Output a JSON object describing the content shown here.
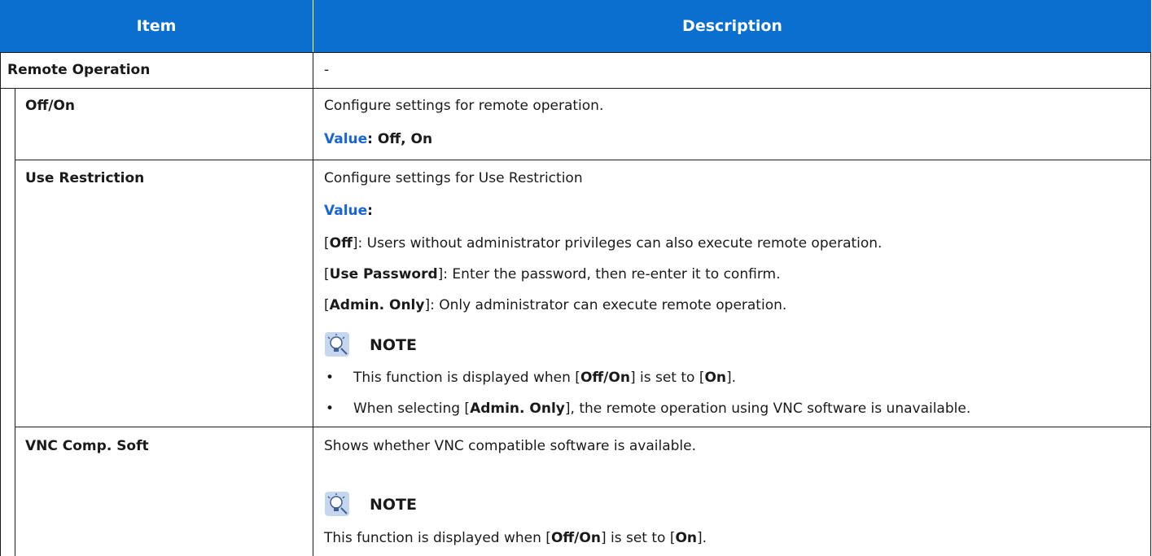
{
  "header": {
    "item": "Item",
    "description": "Description"
  },
  "rows": {
    "remote_operation": {
      "item": "Remote Operation",
      "description": "-"
    },
    "off_on": {
      "item": "Off/On",
      "line1": "Configure settings for remote operation.",
      "value_label": "Value",
      "value_text": ": Off, On"
    },
    "use_restriction": {
      "item": "Use Restriction",
      "line1": "Configure settings for Use Restriction",
      "value_label": "Value",
      "value_colon": ":",
      "opt1_open": "[",
      "opt1_key": "Off",
      "opt1_text": "]: Users without administrator privileges can also execute remote operation.",
      "opt2_open": "[",
      "opt2_key": "Use Password",
      "opt2_text": "]: Enter the password, then re-enter it to confirm.",
      "opt3_open": "[",
      "opt3_key": "Admin. Only",
      "opt3_text": "]: Only administrator can execute remote operation.",
      "note_title": "NOTE",
      "bullet_char": "•",
      "b1_a": "This function is displayed when [",
      "b1_k1": "Off/On",
      "b1_b": "] is set to [",
      "b1_k2": "On",
      "b1_c": "].",
      "b2_a": "When selecting [",
      "b2_k1": "Admin. Only",
      "b2_b": "], the remote operation using VNC software is unavailable."
    },
    "vnc_comp_soft": {
      "item": "VNC Comp. Soft",
      "line1": "Shows whether VNC compatible software is available.",
      "note_title": "NOTE",
      "n_a": "This function is displayed when [",
      "n_k1": "Off/On",
      "n_b": "] is set to [",
      "n_k2": "On",
      "n_c": "]."
    }
  },
  "colors": {
    "header_bg": "#0a6fcf",
    "accent_blue": "#1765d6",
    "border": "#1a1a1a"
  },
  "icons": {
    "note": "note-lightbulb-icon"
  }
}
